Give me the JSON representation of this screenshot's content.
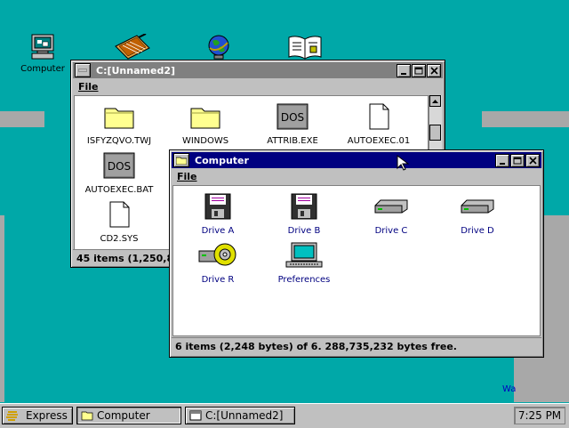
{
  "desktop": {
    "icons": [
      {
        "label": "Computer",
        "icon": "computer-icon"
      },
      {
        "label": "",
        "icon": "notebook-icon"
      },
      {
        "label": "",
        "icon": "globe-icon"
      },
      {
        "label": "",
        "icon": "book-icon"
      }
    ],
    "edge_text": "Wa"
  },
  "window_unnamed": {
    "title": "C:[Unnamed2]",
    "menu": {
      "file": "File"
    },
    "items": [
      {
        "label": "ISFYZQVO.TWJ",
        "icon": "folder-icon"
      },
      {
        "label": "WINDOWS",
        "icon": "folder-icon"
      },
      {
        "label": "ATTRIB.EXE",
        "icon": "dos-icon",
        "icon_text": "DOS"
      },
      {
        "label": "AUTOEXEC.01",
        "icon": "document-icon"
      },
      {
        "label": "AUTOEXEC.BAT",
        "icon": "dos-icon",
        "icon_text": "DOS"
      },
      {
        "label": "CD2.SYS",
        "icon": "document-icon"
      }
    ],
    "status": "45 items (1,250,89"
  },
  "window_computer": {
    "title": "Computer",
    "menu": {
      "file": "File"
    },
    "items": [
      {
        "label": "Drive A",
        "icon": "floppy-icon"
      },
      {
        "label": "Drive B",
        "icon": "floppy-icon"
      },
      {
        "label": "Drive C",
        "icon": "hard-drive-icon"
      },
      {
        "label": "Drive D",
        "icon": "hard-drive-icon"
      },
      {
        "label": "Drive R",
        "icon": "cdrom-icon"
      },
      {
        "label": "Preferences",
        "icon": "preferences-icon"
      }
    ],
    "status": "6 items (2,248 bytes) of 6.  288,735,232 bytes free."
  },
  "taskbar": {
    "start_label": "Express",
    "tasks": [
      {
        "label": "Computer",
        "active": true
      },
      {
        "label": "C:[Unnamed2]",
        "active": false
      }
    ],
    "clock": "7:25 PM"
  },
  "colors": {
    "desktop": "#00a8a8",
    "active_title": "#000080",
    "inactive_title": "#808080",
    "chrome": "#c0c0c0"
  }
}
